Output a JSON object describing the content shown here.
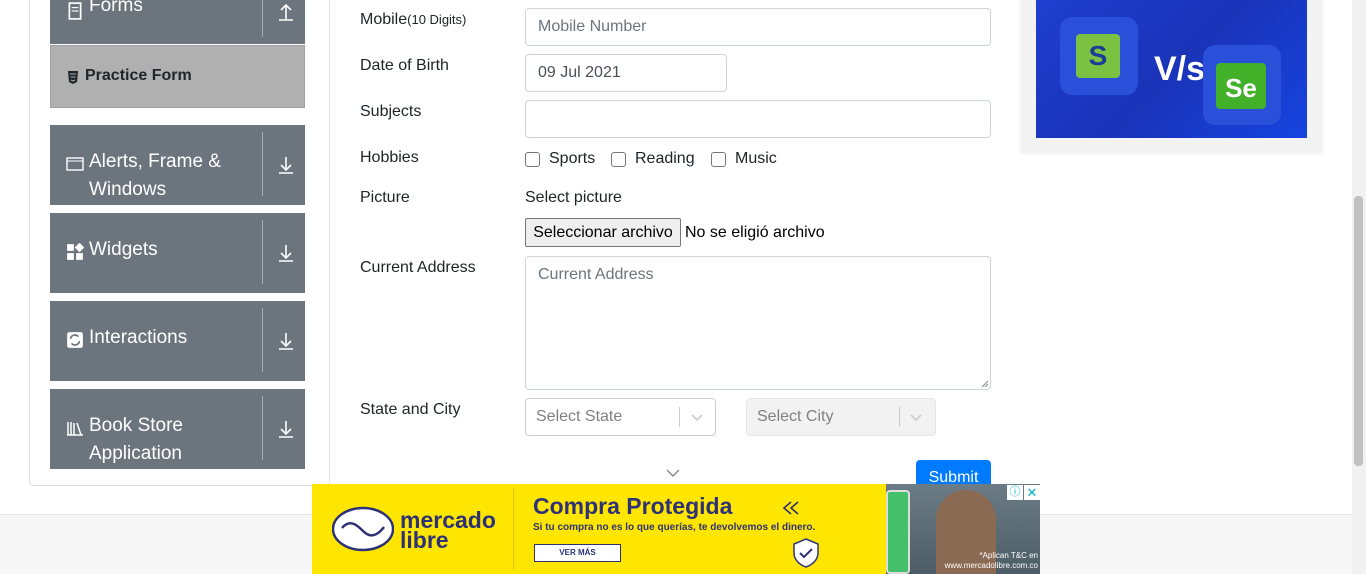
{
  "sidebar": {
    "forms_label": "Forms",
    "practice_form_label": "Practice Form",
    "groups": [
      {
        "label_line1": "Alerts, Frame &",
        "label_line2": "Windows"
      },
      {
        "label_line1": "Widgets"
      },
      {
        "label_line1": "Interactions"
      },
      {
        "label_line1": "Book Store",
        "label_line2": "Application"
      }
    ]
  },
  "form": {
    "mobile_label": "Mobile",
    "mobile_hint": "(10 Digits)",
    "mobile_placeholder": "Mobile Number",
    "dob_label": "Date of Birth",
    "dob_value": "09 Jul 2021",
    "subjects_label": "Subjects",
    "subjects_value": "",
    "hobbies_label": "Hobbies",
    "hobbies": [
      "Sports",
      "Reading",
      "Music"
    ],
    "picture_label": "Picture",
    "picture_select_label": "Select picture",
    "file_button_label": "Seleccionar archivo",
    "file_status": "No se eligió archivo",
    "address_label": "Current Address",
    "address_placeholder": "Current Address",
    "state_city_label": "State and City",
    "state_placeholder": "Select State",
    "city_placeholder": "Select City",
    "submit_label": "Submit"
  },
  "ad_top": {
    "badge_left": "S",
    "vs_text": "V/s",
    "badge_right": "Se"
  },
  "ad_bottom": {
    "brand_line1": "mercado",
    "brand_line2": "libre",
    "title": "Compra Protegida",
    "subtitle": "Si tu compra no es lo que querías, te devolvemos el dinero.",
    "button": "VER MÁS",
    "legal_line1": "*Aplican T&C en",
    "legal_line2": "www.mercadolibre.com.co",
    "info": "ⓘ",
    "close": "✕"
  }
}
